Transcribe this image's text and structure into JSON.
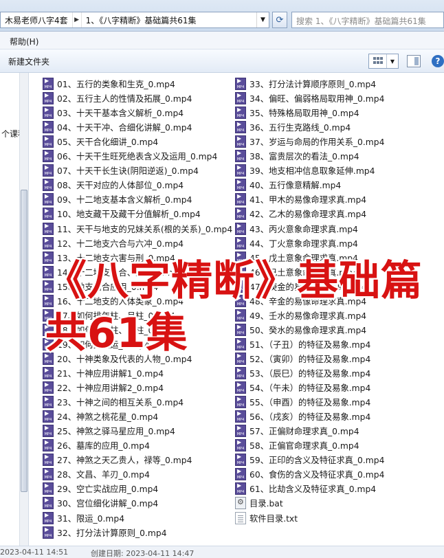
{
  "address": {
    "crumbs": [
      "木易老师八字4套",
      "1、《八字精断》基础篇共61集"
    ],
    "search_placeholder": "搜索 1、《八字精断》基础篇共61集"
  },
  "menu": {
    "help": "帮助(H)"
  },
  "toolbar": {
    "new_folder": "新建文件夹"
  },
  "nav": {
    "item": "个课程"
  },
  "files": [
    "01、五行的类象和生克_0.mp4",
    "02、五行主人的性情及拓展_0.mp4",
    "03、十天干基本含义解析_0.mp4",
    "04、十天干冲、合细化讲解_0.mp4",
    "05、天干合化细讲_0.mp4",
    "06、十天干生旺死绝表含义及运用_0.mp4",
    "07、十天干长生诀(阴阳逆返)_0.mp4",
    "08、天干对应的人体部位_0.mp4",
    "09、十二地支基本含义解析_0.mp4",
    "10、地支藏干及藏干分值解析_0.mp4",
    "11、天干与地支的兄妹关系(根的关系)_0.mp4",
    "12、十二地支六合与六冲_0.mp4",
    "13、十二地支六害与刑_0.mp4",
    "14、十二地支三合、三会_0.mp4",
    "15、地支暗合应用_0.mp4",
    "16、十二地支的人体类象_0.mp4",
    "17、如何排年柱、月柱_0.mp4",
    "18、如何排日柱、时柱_0.mp4",
    "19、如何排大运_0.mp4",
    "20、十神类象及代表的人物_0.mp4",
    "21、十神应用讲解1_0.mp4",
    "22、十神应用讲解2_0.mp4",
    "23、十神之间的相互关系_0.mp4",
    "24、神煞之桃花星_0.mp4",
    "25、神煞之驿马星应用_0.mp4",
    "26、墓库的应用_0.mp4",
    "27、神煞之天乙贵人，禄等_0.mp4",
    "28、文昌、羊刃_0.mp4",
    "29、空亡实战应用_0.mp4",
    "30、宫位细化讲解_0.mp4",
    "31、限运_0.mp4",
    "32、打分法计算原则_0.mp4",
    "33、打分法计算顺序原则_0.mp4",
    "34、偏旺、偏弱格局取用神_0.mp4",
    "35、特殊格局取用神_0.mp4",
    "36、五行生克路线_0.mp4",
    "37、岁运与命局的作用关系_0.mp4",
    "38、富贵层次的看法_0.mp4",
    "39、地支相冲信息取象延伸.mp4",
    "40、五行像意精解.mp4",
    "41、甲木的易像命理求真.mp4",
    "42、乙木的易像命理求真.mp4",
    "43、丙火意象命理求真.mp4",
    "44、丁火意象命理求真.mp4",
    "45、戊土意象命理求真.mp4",
    "46、己土意象命理求真.mp4",
    "47、庚金的易像命理求真.mp4",
    "48、辛金的易像命理求真.mp4",
    "49、壬水的易像命理求真.mp4",
    "50、癸水的易像命理求真.mp4",
    "51、（子丑）的特征及易象.mp4",
    "52、（寅卯）的特征及易象.mp4",
    "53、（辰巳）的特征及易象.mp4",
    "54、（午未）的特征及易象.mp4",
    "55、（申酉）的特征及易象.mp4",
    "56、（戌亥）的特征及易象.mp4",
    "57、正偏财命理求真_0.mp4",
    "58、正偏官命理求真_0.mp4",
    "59、正印的含义及特征求真_0.mp4",
    "60、食伤的含义及特征求真_0.mp4",
    "61、比劫含义及特征求真_0.mp4",
    "目录.bat",
    "软件目录.txt"
  ],
  "overlay": {
    "line1": "《八字精断》基础篇",
    "line2": "共61集"
  },
  "status": {
    "modified": "2023-04-11 14:51",
    "created": "创建日期: 2023-04-11 14:47"
  }
}
